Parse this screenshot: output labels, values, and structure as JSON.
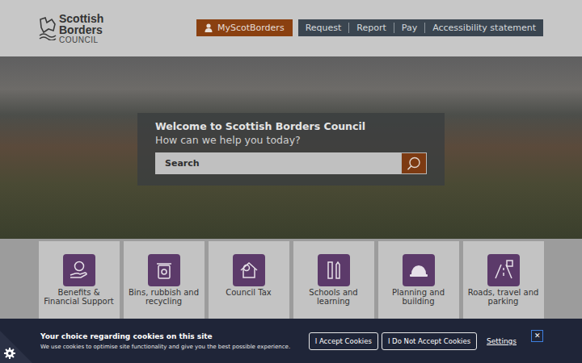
{
  "header": {
    "logo": {
      "line1": "Scottish",
      "line2": "Borders",
      "line3": "COUNCIL"
    },
    "account_button": "MyScotBorders",
    "nav": [
      "Request",
      "Report",
      "Pay",
      "Accessibility statement"
    ]
  },
  "hero": {
    "title": "Welcome to Scottish Borders Council",
    "subtitle": "How can we help you today?",
    "search": {
      "placeholder": "Search"
    }
  },
  "services": [
    {
      "label": "Benefits & Financial Support"
    },
    {
      "label": "Bins, rubbish and recycling"
    },
    {
      "label": "Council Tax"
    },
    {
      "label": "Schools and learning"
    },
    {
      "label": "Planning and building"
    },
    {
      "label": "Roads, travel and parking"
    }
  ],
  "cookie_banner": {
    "title": "Your choice regarding cookies on this site",
    "text": "We use cookies to optimise site functionality and give you the best possible experience.",
    "buttons": [
      "I Accept Cookies",
      "I Do Not Accept Cookies"
    ],
    "settings_link": "Settings",
    "close": "✕"
  }
}
